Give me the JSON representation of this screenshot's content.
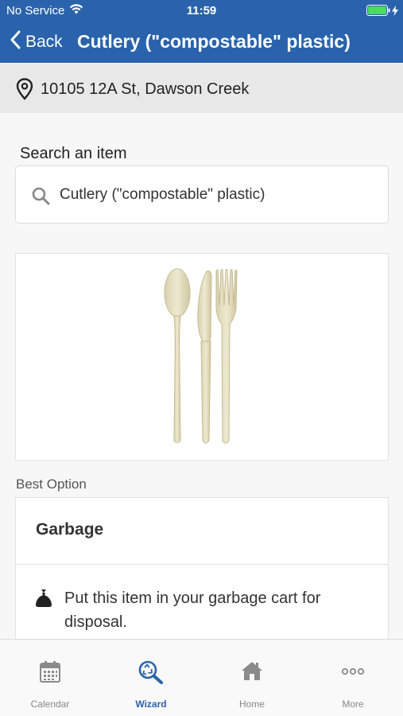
{
  "status_bar": {
    "carrier": "No Service",
    "time": "11:59",
    "wifi_icon": "wifi-icon",
    "battery_icon": "battery-icon",
    "charging_icon": "charging-bolt-icon"
  },
  "nav": {
    "back_label": "Back",
    "title": "Cutlery (\"compostable\" plastic)",
    "bar_color": "#2a63ab"
  },
  "address": {
    "icon": "location-pin-icon",
    "text": "10105 12A St, Dawson Creek"
  },
  "search": {
    "label": "Search an item",
    "value": "Cutlery (\"compostable\" plastic)",
    "icon": "search-icon"
  },
  "item_image": {
    "depicts": "cutlery-image"
  },
  "best_option": {
    "section_label": "Best Option",
    "title": "Garbage",
    "instruction_icon": "garbage-bag-icon",
    "instruction": "Put this item in your garbage cart for disposal."
  },
  "tabs": [
    {
      "label": "Calendar",
      "icon": "calendar-icon",
      "active": false
    },
    {
      "label": "Wizard",
      "icon": "recycle-search-icon",
      "active": true
    },
    {
      "label": "Home",
      "icon": "home-icon",
      "active": false
    },
    {
      "label": "More",
      "icon": "more-icon",
      "active": false
    }
  ],
  "colors": {
    "accent": "#2a63ab",
    "inactive_tab": "#888888"
  }
}
